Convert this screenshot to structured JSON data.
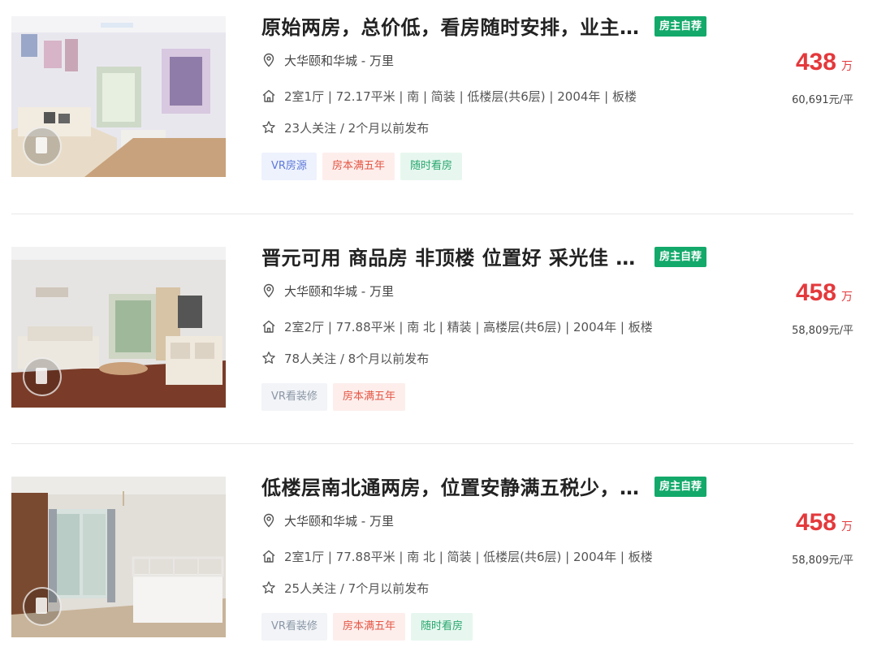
{
  "listings": [
    {
      "title": "原始两房，总价低，看房随时安排，业主诚心出售",
      "owner_tag": "房主自荐",
      "community": "大华颐和华城",
      "area": "万里",
      "info": "2室1厅 | 72.17平米 | 南 | 简装 | 低楼层(共6层) | 2004年 | 板楼",
      "follow": "23人关注 / 2个月以前发布",
      "tags": [
        "VR房源",
        "房本满五年",
        "随时看房"
      ],
      "total_price": "438",
      "price_unit": "万",
      "unit_price": "60,691元/平"
    },
    {
      "title": "晋元可用 商品房 非顶楼 位置好 采光佳 满五年",
      "owner_tag": "房主自荐",
      "community": "大华颐和华城",
      "area": "万里",
      "info": "2室2厅 | 77.88平米 | 南 北 | 精装 | 高楼层(共6层) | 2004年 | 板楼",
      "follow": "78人关注 / 8个月以前发布",
      "tags": [
        "VR看装修",
        "房本满五年"
      ],
      "total_price": "458",
      "price_unit": "万",
      "unit_price": "58,809元/平"
    },
    {
      "title": "低楼层南北通两房，位置安静满五税少，看房方便",
      "owner_tag": "房主自荐",
      "community": "大华颐和华城",
      "area": "万里",
      "info": "2室1厅 | 77.88平米 | 南 北 | 简装 | 低楼层(共6层) | 2004年 | 板楼",
      "follow": "25人关注 / 7个月以前发布",
      "tags": [
        "VR看装修",
        "房本满五年",
        "随时看房"
      ],
      "total_price": "458",
      "price_unit": "万",
      "unit_price": "58,809元/平"
    }
  ],
  "address_separator": "-",
  "icons": {
    "location": "location-pin-icon",
    "house": "house-icon",
    "star": "star-icon",
    "vr": "vr-icon"
  },
  "colors": {
    "price": "#e4393c",
    "owner_tag": "#13a96a",
    "vr_tag": "#5d79d8",
    "five_year_tag": "#e45745",
    "visit_tag": "#28a86e"
  }
}
